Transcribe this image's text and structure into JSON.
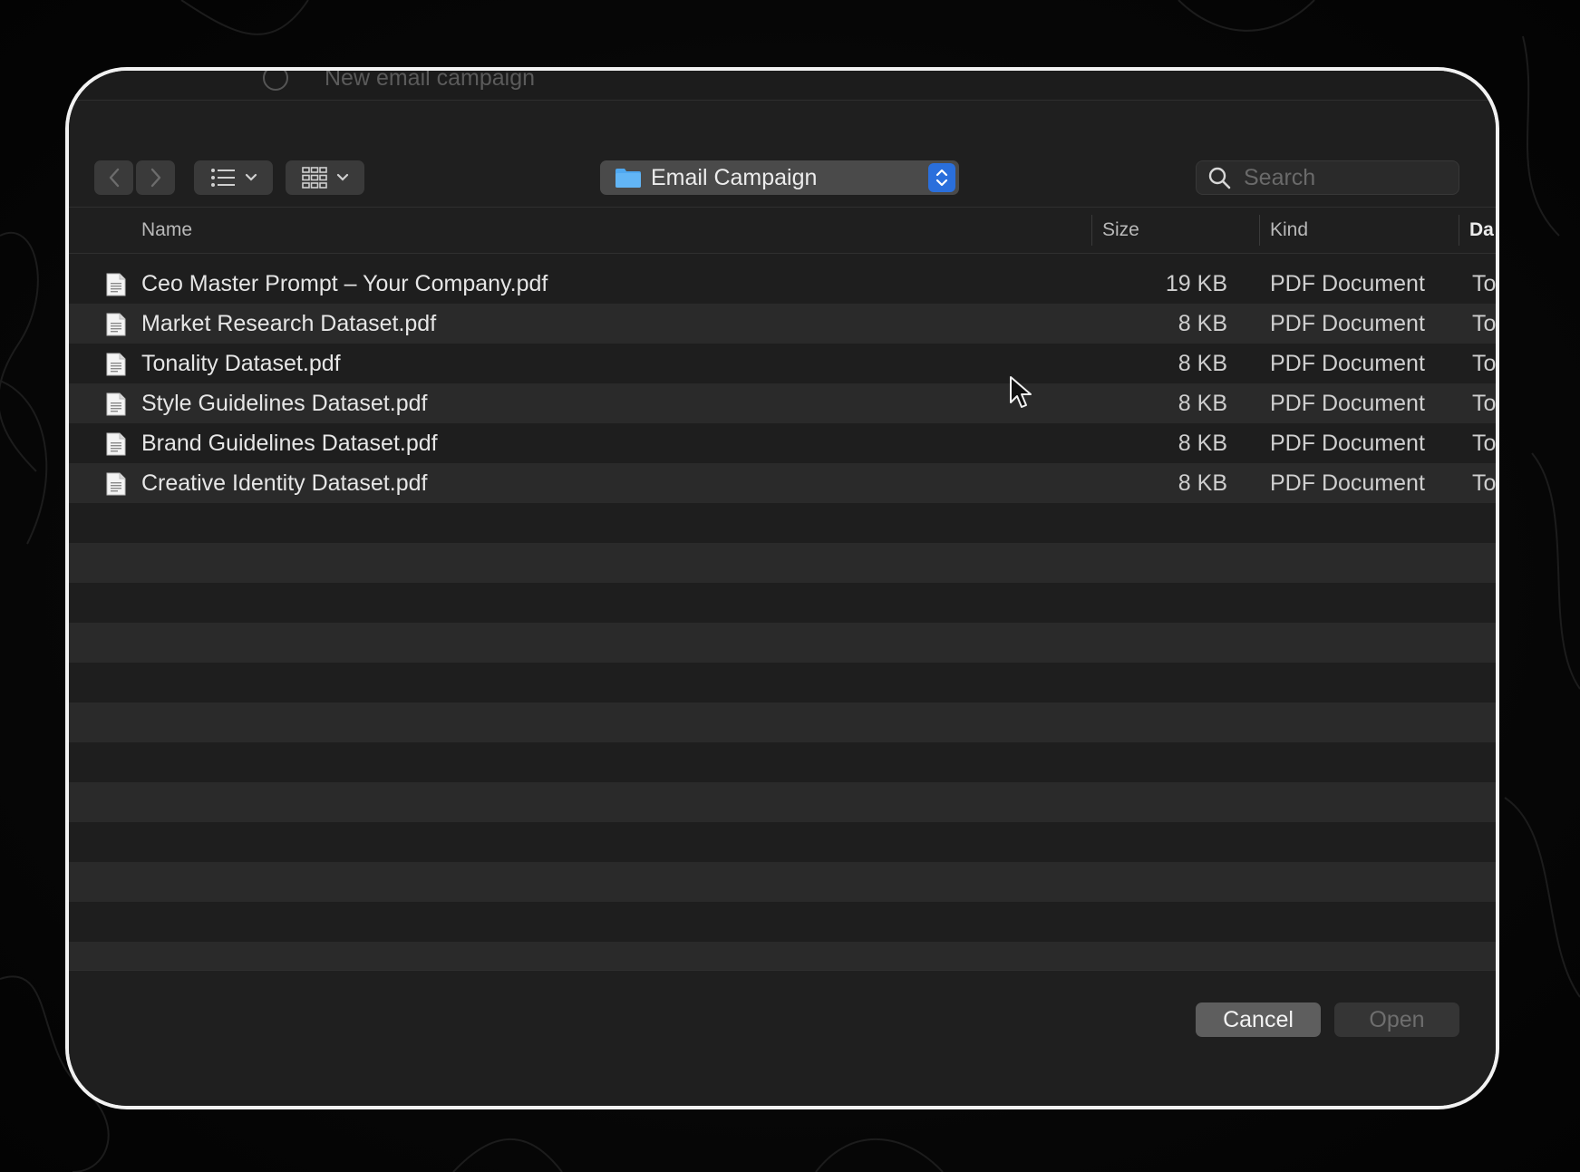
{
  "background_app": {
    "title": "New email campaign"
  },
  "toolbar": {
    "back_icon": "chevron-left-icon",
    "forward_icon": "chevron-right-icon",
    "list_view_icon": "list-view-icon",
    "grid_view_icon": "grid-view-icon",
    "location": "Email Campaign",
    "search_placeholder": "Search"
  },
  "columns": {
    "name": "Name",
    "size": "Size",
    "kind": "Kind",
    "date": "Da"
  },
  "files": [
    {
      "name": "Ceo Master Prompt – Your Company.pdf",
      "size": "19 KB",
      "kind": "PDF Document",
      "date": "To"
    },
    {
      "name": "Market Research Dataset.pdf",
      "size": "8 KB",
      "kind": "PDF Document",
      "date": "To"
    },
    {
      "name": "Tonality Dataset.pdf",
      "size": "8 KB",
      "kind": "PDF Document",
      "date": "To"
    },
    {
      "name": "Style Guidelines Dataset.pdf",
      "size": "8 KB",
      "kind": "PDF Document",
      "date": "To"
    },
    {
      "name": "Brand Guidelines Dataset.pdf",
      "size": "8 KB",
      "kind": "PDF Document",
      "date": "To"
    },
    {
      "name": "Creative Identity Dataset.pdf",
      "size": "8 KB",
      "kind": "PDF Document",
      "date": "To"
    }
  ],
  "footer": {
    "cancel_label": "Cancel",
    "open_label": "Open"
  },
  "colors": {
    "accent": "#2a6fdc",
    "folder": "#4fa8f0",
    "window_border": "#f2f2f2"
  }
}
